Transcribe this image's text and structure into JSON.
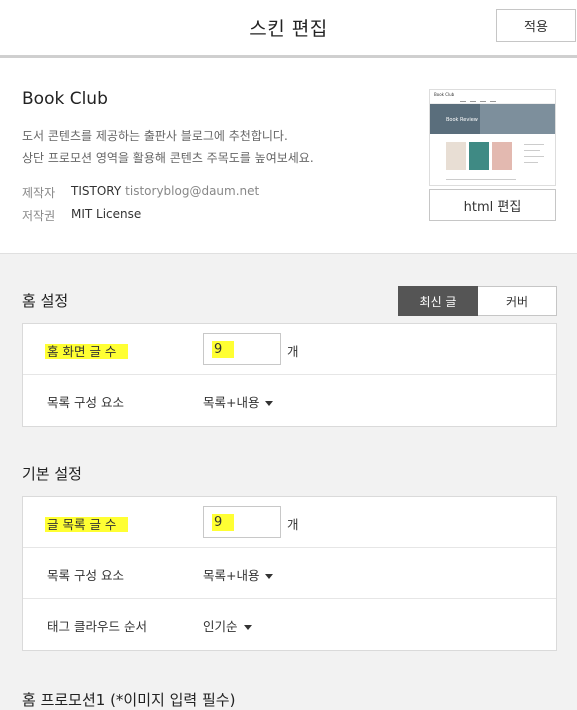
{
  "header": {
    "title": "스킨 편집",
    "apply_label": "적용"
  },
  "skin": {
    "name": "Book Club",
    "description_line1": "도서 콘텐츠를 제공하는 출판사 블로그에 추천합니다.",
    "description_line2": "상단 프로모션 영역을 활용해 콘텐츠 주목도를 높여보세요.",
    "maker_key": "제작자",
    "maker_name": "TISTORY",
    "maker_email": "tistoryblog@daum.net",
    "license_key": "저작권",
    "license_value": "MIT License",
    "thumbnail": {
      "logo": "Book Club",
      "hero_text": "Book Review"
    },
    "html_edit_label": "html 편집"
  },
  "home_settings": {
    "title": "홈 설정",
    "tabs": [
      {
        "label": "최신 글",
        "active": true
      },
      {
        "label": "커버",
        "active": false
      }
    ],
    "post_count_label": "홈 화면 글 수",
    "post_count_value": "9",
    "post_count_unit": "개",
    "list_layout_label": "목록 구성 요소",
    "list_layout_value": "목록+내용"
  },
  "basic_settings": {
    "title": "기본 설정",
    "post_count_label": "글 목록 글 수",
    "post_count_value": "9",
    "post_count_unit": "개",
    "list_layout_label": "목록 구성 요소",
    "list_layout_value": "목록+내용",
    "tag_cloud_label": "태그 클라우드 순서",
    "tag_cloud_value": "인기순"
  },
  "promotion": {
    "title": "홈 프로모션1 (*이미지 입력 필수)"
  },
  "colors": {
    "highlight": "#ffff33",
    "active_tab": "#555555"
  }
}
